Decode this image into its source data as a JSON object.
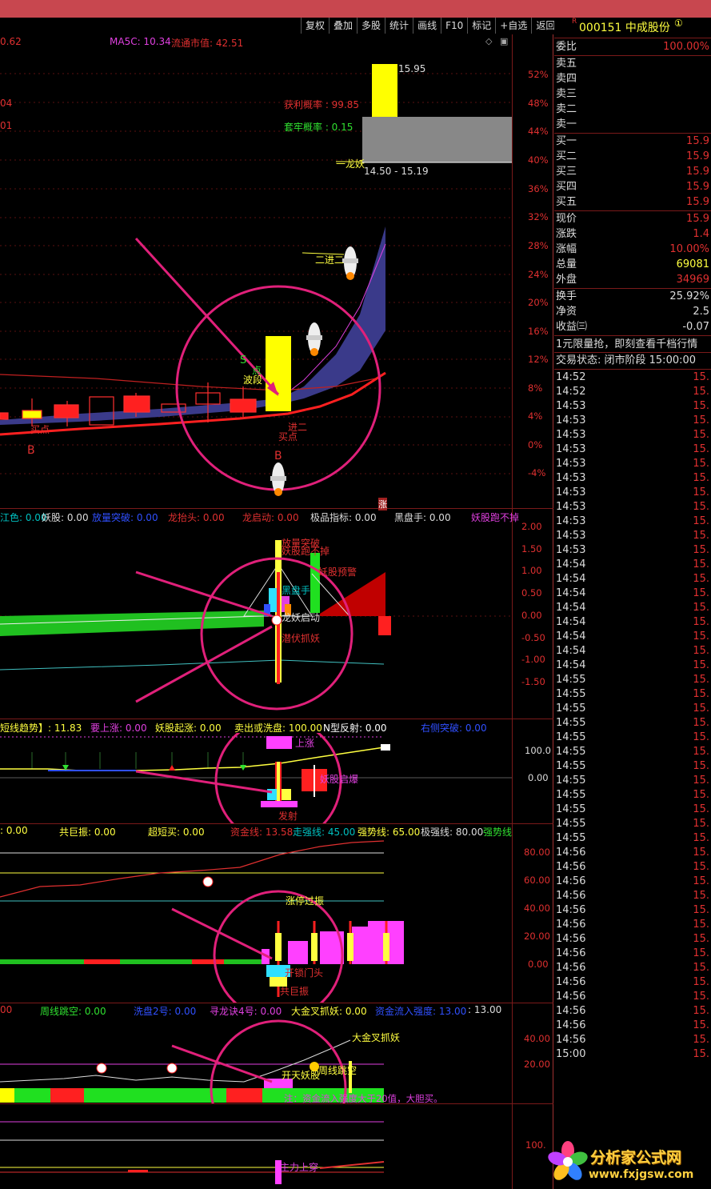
{
  "toolbar": [
    "复权",
    "叠加",
    "多股",
    "统计",
    "画线",
    "F10",
    "标记",
    "+自选",
    "返回"
  ],
  "stock": {
    "marker": "R",
    "code_name": "000151 中成股份",
    "circle": "①"
  },
  "main_header": {
    "left_value": "0.62",
    "ma5c": "MA5C: 10.34",
    "float_mv": "流通市值: 42.51"
  },
  "main_pct_axis": [
    "52%",
    "48%",
    "44%",
    "40%",
    "36%",
    "32%",
    "28%",
    "24%",
    "20%",
    "16%",
    "12%",
    "8%",
    "4%",
    "0%",
    "-4%"
  ],
  "main_labels": {
    "top_price": "15.95",
    "profit_prob": "获利概率 : 99.85",
    "trap_prob": "套牢概率 : 0.15",
    "yilong": "一龙妖",
    "range": "14.50 - 15.19",
    "erjin": "二进二",
    "left1": "04",
    "left2": "01",
    "s_mark": "S",
    "boduan": "波段",
    "dian": "点",
    "maidian_a": "买点",
    "jin_er": "进二",
    "maidian_b": "买点",
    "b1": "B",
    "b2": "B",
    "zhang": "涨"
  },
  "ind1": {
    "header": [
      {
        "t": "江色: 0.00",
        "c": "#00c0c0"
      },
      {
        "t": "妖股: 0.00",
        "c": "#dddddd"
      },
      {
        "t": "放量突破: 0.00",
        "c": "#3050ff"
      },
      {
        "t": "龙抬头: 0.00",
        "c": "#e03030"
      },
      {
        "t": "龙启动: 0.00",
        "c": "#e03030"
      },
      {
        "t": "极品指标: 0.00",
        "c": "#dddddd"
      },
      {
        "t": "黑盘手: 0.00",
        "c": "#dddddd"
      },
      {
        "t": "妖股跑不掉",
        "c": "#e040e0"
      }
    ],
    "axis": [
      "2.00",
      "1.50",
      "1.00",
      "0.50",
      "0.00",
      "-0.50",
      "-1.00",
      "-1.50"
    ],
    "labels": {
      "fangliang": "放量突破",
      "yaogu_pao": "妖股跑不掉",
      "yaogu_yujing": "妖股预警",
      "heipanshou": "黑盘手",
      "longyao": "龙妖启动",
      "qianfu": "潜伏抓妖"
    }
  },
  "ind2": {
    "header": [
      {
        "t": "短线趋势】: 11.83",
        "c": "#ffff40"
      },
      {
        "t": "要上涨: 0.00",
        "c": "#e040e0"
      },
      {
        "t": "妖股起涨: 0.00",
        "c": "#ffff40"
      },
      {
        "t": "卖出或洗盘: 100.00",
        "c": "#ffff40"
      },
      {
        "t": "N型反射: 0.00",
        "c": "#ffffff"
      },
      {
        "t": "右侧突破: 0.00",
        "c": "#3050ff"
      }
    ],
    "axis": [
      "100.0",
      "0.00"
    ],
    "labels": {
      "shangzhang": "上涨",
      "yaogu_qibao": "妖股启爆",
      "fashe": "发射"
    }
  },
  "ind3": {
    "header": [
      {
        "t": ": 0.00",
        "c": "#ffff40"
      },
      {
        "t": "共巨振: 0.00",
        "c": "#ffff40"
      },
      {
        "t": "超短买: 0.00",
        "c": "#ffff40"
      },
      {
        "t": "资金线: 13.58",
        "c": "#e03030"
      },
      {
        "t": "走强线: 45.00",
        "c": "#00c0c0"
      },
      {
        "t": "强势线: 65.00",
        "c": "#ffff40"
      },
      {
        "t": "极强线: 80.00",
        "c": "#dddddd"
      },
      {
        "t": "强势线",
        "c": "#30e030"
      }
    ],
    "axis": [
      "80.00",
      "60.00",
      "40.00",
      "20.00",
      "0.00"
    ],
    "labels": {
      "zhangting": "涨停过振",
      "kaisuo": "开锁门头",
      "gongjuzhen": "共巨振"
    }
  },
  "ind4": {
    "header": [
      {
        "t": "00",
        "c": "#e03030"
      },
      {
        "t": "周线跳空: 0.00",
        "c": "#30e030"
      },
      {
        "t": "洗盘2号: 0.00",
        "c": "#3050ff"
      },
      {
        "t": "寻龙诀4号: 0.00",
        "c": "#e040e0"
      },
      {
        "t": "大金叉抓妖: 0.00",
        "c": "#ffff40"
      },
      {
        "t": "资金流入强度: 13.00",
        "c": "#3050ff"
      },
      {
        "t": ": 13.00",
        "c": "#dddddd"
      }
    ],
    "axis": [
      "40.00",
      "20.00"
    ],
    "labels": {
      "dajincha": "大金叉抓妖",
      "kaitian": "开天妖股",
      "zhouxian": "周线跳空",
      "note": "注：资金流入强度大于20值，大胆买。"
    }
  },
  "ind5": {
    "axis": [
      "100."
    ],
    "labels": {
      "zhuli": "主力上穿"
    }
  },
  "quote": {
    "weibi": {
      "l": "委比",
      "r": "100.00%"
    },
    "sell": [
      "卖五",
      "卖四",
      "卖三",
      "卖二",
      "卖一"
    ],
    "buy": [
      {
        "l": "买一",
        "r": "15.9"
      },
      {
        "l": "买二",
        "r": "15.9"
      },
      {
        "l": "买三",
        "r": "15.9"
      },
      {
        "l": "买四",
        "r": "15.9"
      },
      {
        "l": "买五",
        "r": "15.9"
      }
    ],
    "stats1": [
      {
        "l": "现价",
        "r": "15.9"
      },
      {
        "l": "涨跌",
        "r": "1.4"
      },
      {
        "l": "涨幅",
        "r": "10.00%"
      },
      {
        "l": "总量",
        "r": "69081"
      },
      {
        "l": "外盘",
        "r": "34969"
      }
    ],
    "stats2": [
      {
        "l": "换手",
        "r": "25.92%"
      },
      {
        "l": "净资",
        "r": "2.5"
      },
      {
        "l": "收益㈢",
        "r": "-0.07"
      }
    ],
    "promo": "1元限量抢，即刻查看千档行情",
    "status": "交易状态: 闭市阶段 15:00:00",
    "ticks": [
      "14:52",
      "14:52",
      "14:53",
      "14:53",
      "14:53",
      "14:53",
      "14:53",
      "14:53",
      "14:53",
      "14:53",
      "14:53",
      "14:53",
      "14:53",
      "14:54",
      "14:54",
      "14:54",
      "14:54",
      "14:54",
      "14:54",
      "14:54",
      "14:54",
      "14:55",
      "14:55",
      "14:55",
      "14:55",
      "14:55",
      "14:55",
      "14:55",
      "14:55",
      "14:55",
      "14:55",
      "14:55",
      "14:55",
      "14:56",
      "14:56",
      "14:56",
      "14:56",
      "14:56",
      "14:56",
      "14:56",
      "14:56",
      "14:56",
      "14:56",
      "14:56",
      "14:56",
      "14:56",
      "14:56",
      "15:00"
    ],
    "tick_price": "15."
  },
  "watermark": {
    "name": "分析家公式网",
    "url": "www.fxjgsw.com"
  }
}
